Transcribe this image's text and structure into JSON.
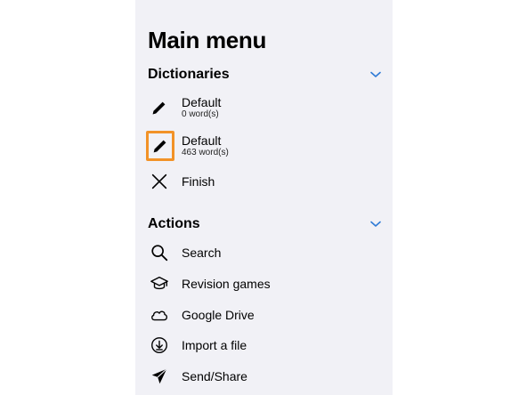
{
  "menu": {
    "title": "Main menu"
  },
  "dictionaries": {
    "header": "Dictionaries",
    "items": [
      {
        "label": "Default",
        "sublabel": "0 word(s)",
        "icon": "pencil-icon"
      },
      {
        "label": "Default",
        "sublabel": "463 word(s)",
        "icon": "pencil-icon"
      },
      {
        "label": "Finish",
        "icon": "close-icon"
      }
    ]
  },
  "actions": {
    "header": "Actions",
    "items": [
      {
        "label": "Search",
        "icon": "search-icon"
      },
      {
        "label": "Revision games",
        "icon": "graduation-cap-icon"
      },
      {
        "label": "Google Drive",
        "icon": "cloud-icon"
      },
      {
        "label": "Import a file",
        "icon": "download-circle-icon"
      },
      {
        "label": "Send/Share",
        "icon": "send-icon"
      }
    ]
  },
  "colors": {
    "accent": "#2f7bd6",
    "highlight": "#f29227",
    "panel_bg": "#f1f1f6"
  }
}
